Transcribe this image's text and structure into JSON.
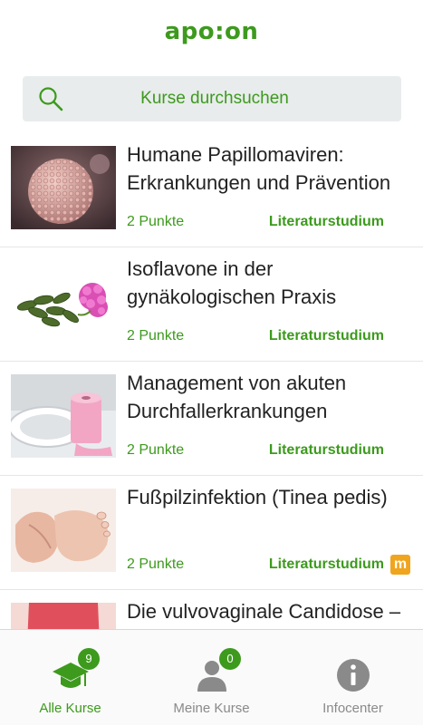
{
  "app": {
    "logo": "apo:on"
  },
  "search": {
    "placeholder": "Kurse durchsuchen"
  },
  "courses": [
    {
      "title": "Humane Papillomaviren: Erkrankungen und Prävention",
      "points": "2 Punkte",
      "type": "Literaturstudium",
      "image": "virus-image"
    },
    {
      "title": "Isoflavone in der gynäkologischen Praxis",
      "points": "2 Punkte",
      "type": "Literaturstudium",
      "image": "pills-flower-image"
    },
    {
      "title": "Management von akuten Durchfallerkrankungen",
      "points": "2 Punkte",
      "type": "Literaturstudium",
      "image": "toilet-paper-image"
    },
    {
      "title": "Fußpilzinfektion (Tinea pedis)",
      "points": "2 Punkte",
      "type": "Literaturstudium",
      "badge": "m",
      "image": "feet-image"
    },
    {
      "title": "Die vulvovaginale Candidose –",
      "points": "",
      "type": "",
      "image": "woman-image"
    }
  ],
  "tabs": [
    {
      "label": "Alle Kurse",
      "count": "9",
      "icon": "graduation-cap-icon",
      "active": true
    },
    {
      "label": "Meine Kurse",
      "count": "0",
      "icon": "user-icon",
      "active": false
    },
    {
      "label": "Infocenter",
      "icon": "info-icon",
      "active": false
    }
  ],
  "colors": {
    "accent": "#3d9a1d",
    "badge_m": "#f0a51e",
    "search_bg": "#e8ecec"
  }
}
